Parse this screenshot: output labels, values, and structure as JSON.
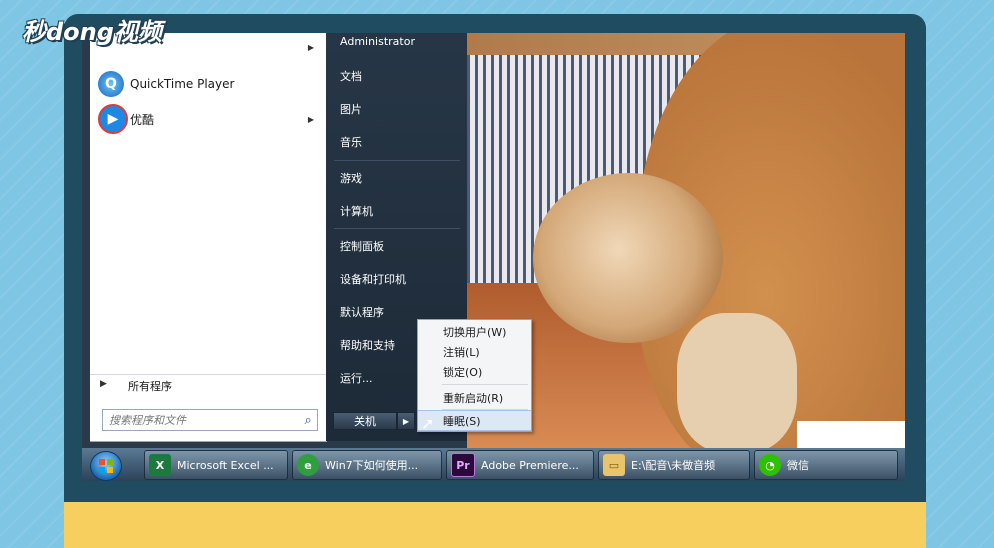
{
  "watermark": "秒dong视频",
  "start_menu": {
    "programs": [
      {
        "label": "",
        "icon": "app-icon-partial",
        "has_arrow": true
      },
      {
        "label": "QuickTime Player",
        "icon": "quicktime-icon",
        "has_arrow": false
      },
      {
        "label": "优酷",
        "icon": "youku-icon",
        "has_arrow": true
      }
    ],
    "all_programs": "所有程序",
    "search_placeholder": "搜索程序和文件",
    "right_items": [
      "Administrator",
      "文档",
      "图片",
      "音乐",
      "游戏",
      "计算机",
      "控制面板",
      "设备和打印机",
      "默认程序",
      "帮助和支持",
      "运行..."
    ],
    "shutdown_label": "关机"
  },
  "power_menu": {
    "items": [
      "切换用户(W)",
      "注销(L)",
      "锁定(O)",
      "重新启动(R)",
      "睡眠(S)"
    ],
    "highlighted": "睡眠(S)"
  },
  "taskbar": {
    "buttons": [
      {
        "label": "Microsoft Excel ...",
        "icon": "excel-icon"
      },
      {
        "label": "Win7下如何使用...",
        "icon": "ie-icon"
      },
      {
        "label": "Adobe Premiere...",
        "icon": "premiere-icon"
      },
      {
        "label": "E:\\配音\\未做音频",
        "icon": "folder-icon"
      },
      {
        "label": "微信",
        "icon": "wechat-icon"
      }
    ]
  },
  "colors": {
    "background": "#7fc6e4",
    "frame": "#204c62",
    "bottom_band": "#f6cf5e",
    "start_right_panel": "#273646"
  }
}
